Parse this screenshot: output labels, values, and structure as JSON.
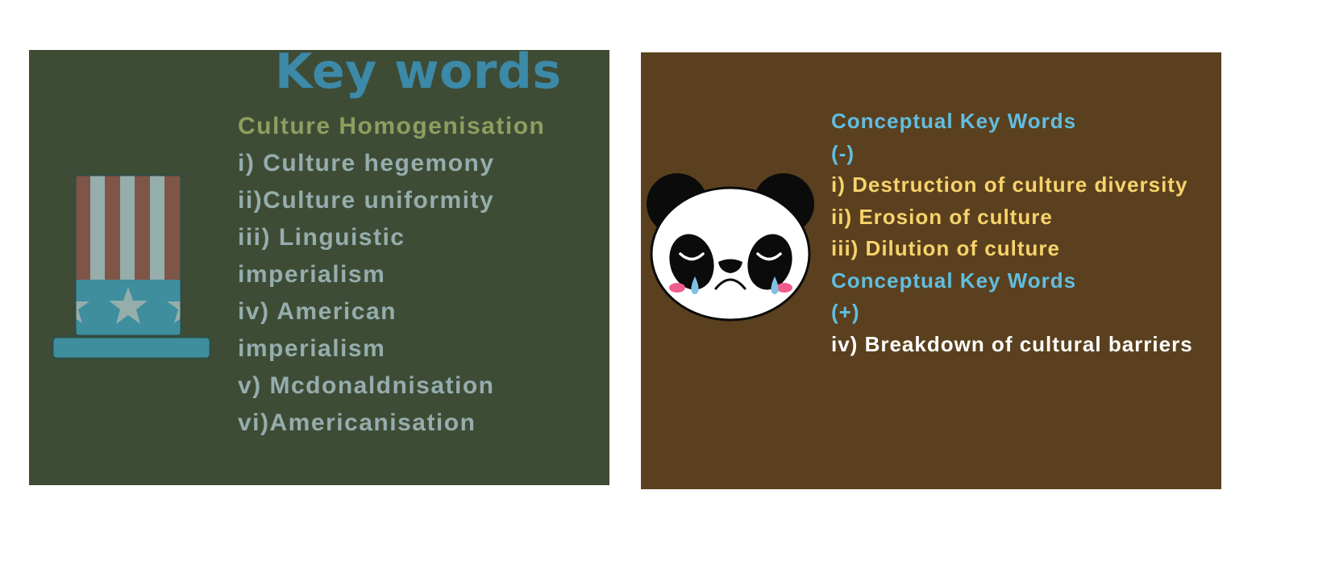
{
  "left_slide": {
    "title": "Key words",
    "subtitle": "Culture Homogenisation",
    "items": [
      "i) Culture hegemony",
      "ii)Culture uniformity",
      "iii) Linguistic",
      "imperialism",
      "iv) American",
      "imperialism",
      "v) Mcdonaldnisation",
      "vi)Americanisation"
    ],
    "colors": {
      "background": "#3e4c36",
      "title": "#3c89a8",
      "subtitle": "#8e9e60",
      "text": "#95adac"
    },
    "illustration": "uncle-sam-hat-icon"
  },
  "right_slide": {
    "heading_negative": "Conceptual Key Words",
    "sign_negative": "(-)",
    "negative_items": [
      "i) Destruction of culture diversity",
      "ii) Erosion of culture",
      "iii) Dilution of culture"
    ],
    "heading_positive": "Conceptual Key Words",
    "sign_positive": "(+)",
    "positive_items": [
      "iv) Breakdown of cultural barriers"
    ],
    "colors": {
      "background": "#5a401e",
      "heading": "#62bddf",
      "negative": "#f7d36b",
      "positive": "#ffffff"
    },
    "illustration": "crying-panda-icon"
  }
}
